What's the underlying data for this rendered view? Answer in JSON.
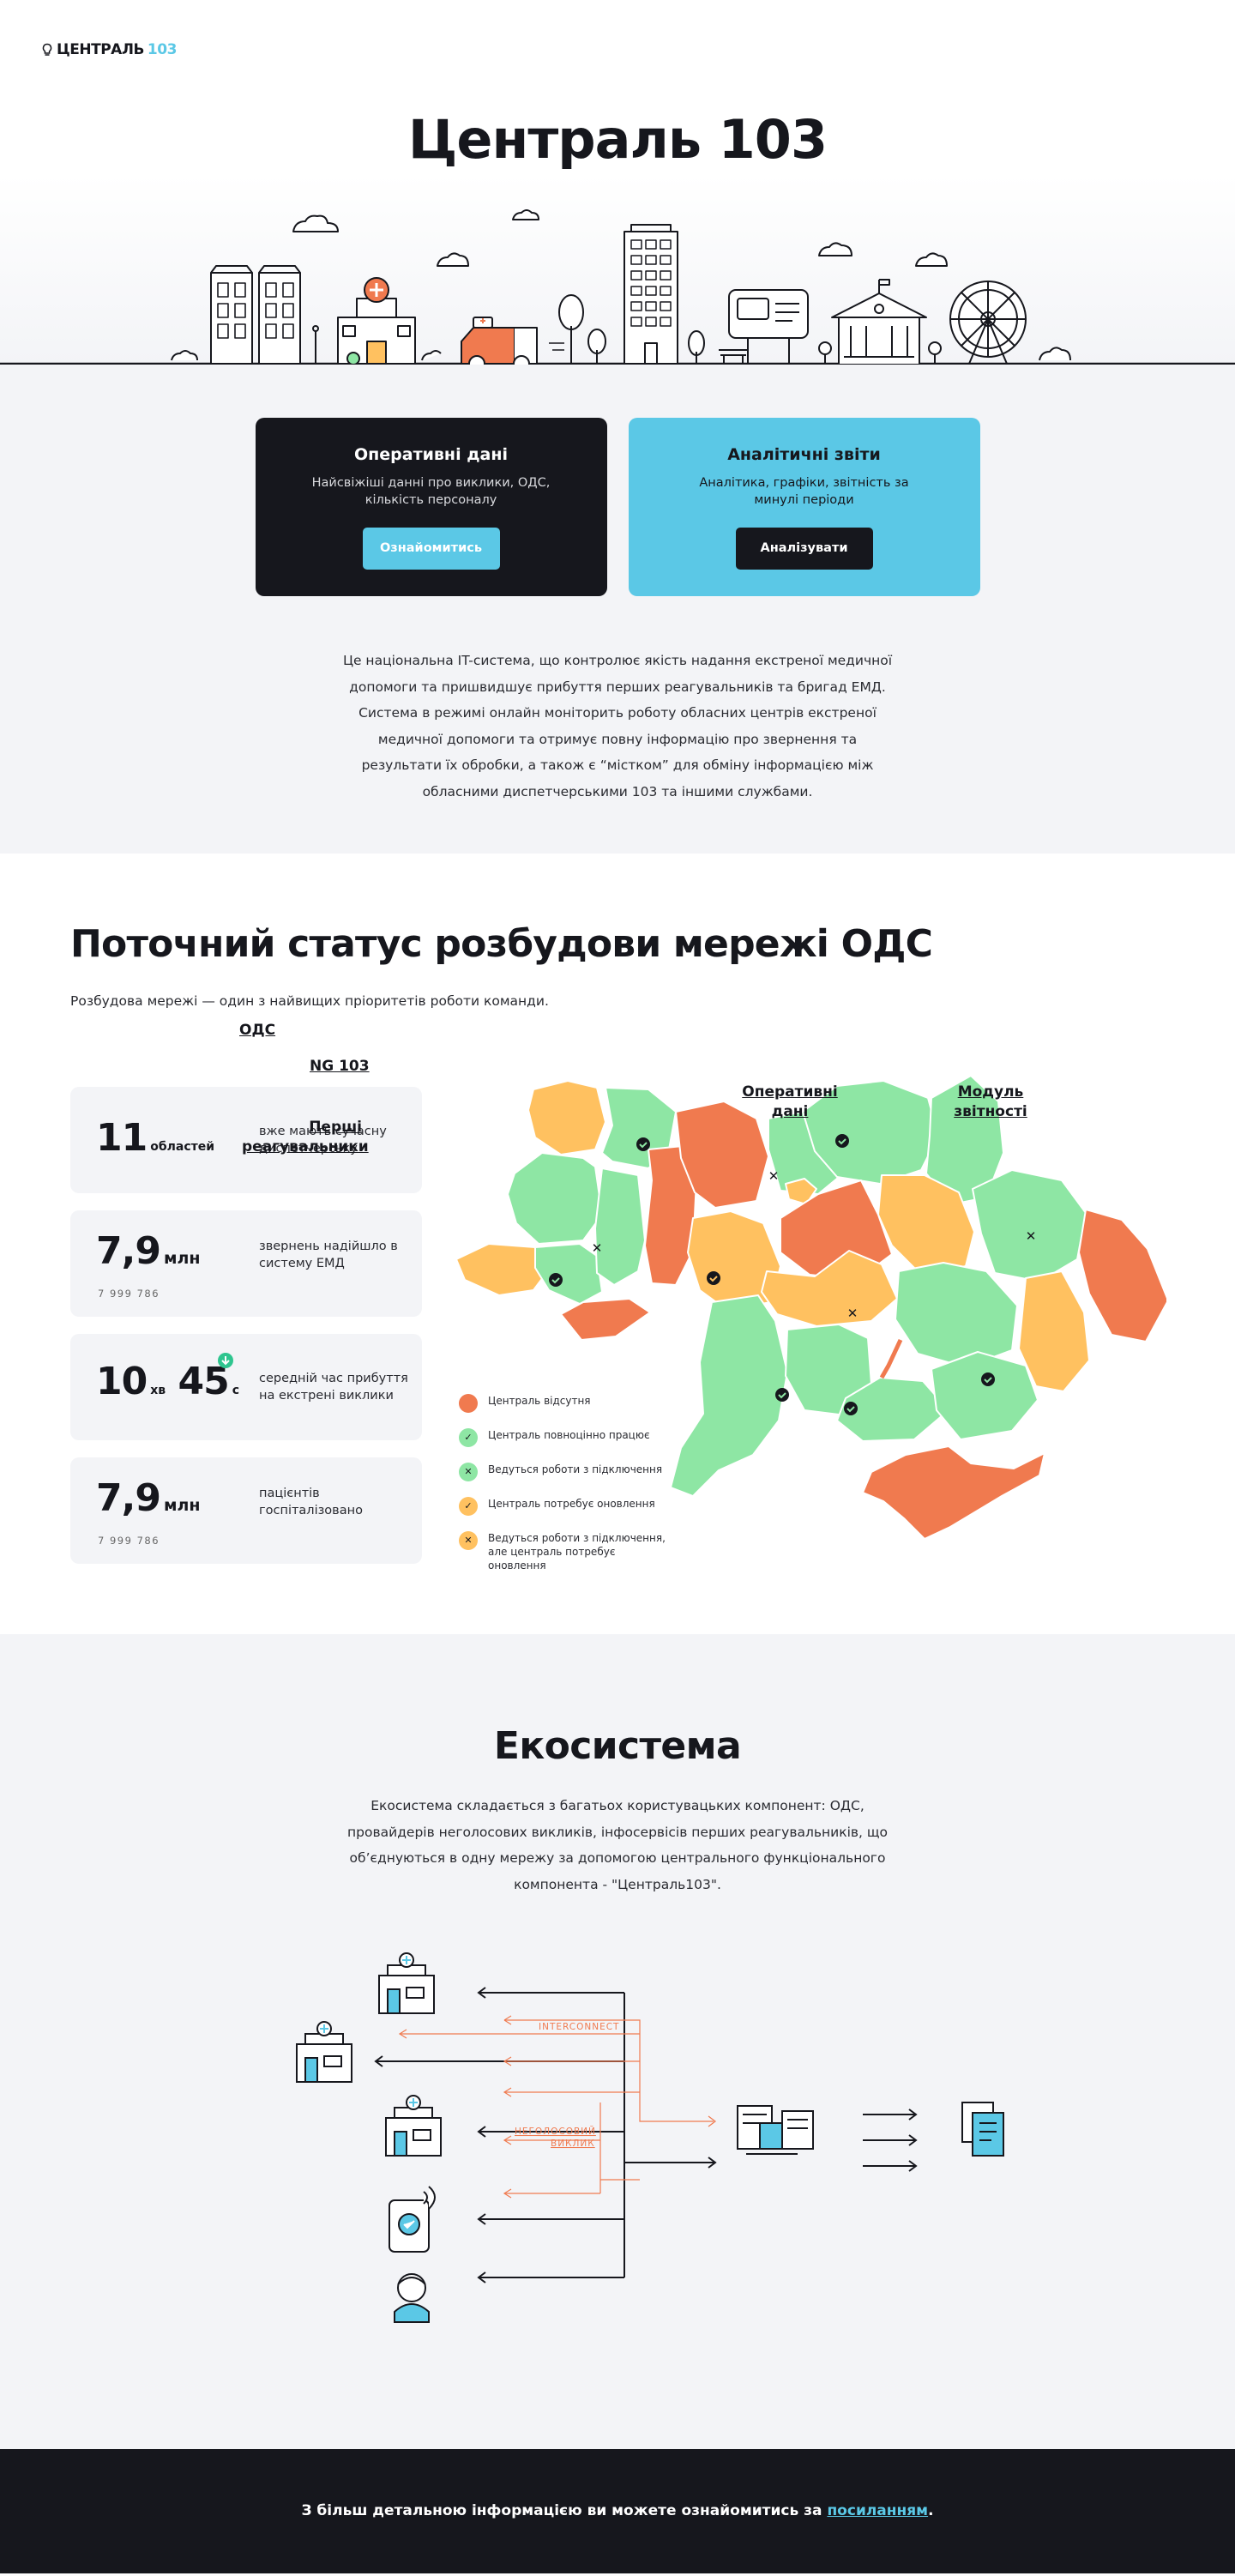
{
  "header": {
    "logo_text": "ЦЕНТРАЛЬ",
    "logo_number": "103",
    "title": "Централь 103"
  },
  "cards": [
    {
      "title": "Оперативні дані",
      "text": "Найсвіжіші данні про виклики, ОДС, кількість персоналу",
      "button": "Ознайомитись"
    },
    {
      "title": "Аналітичні звіти",
      "text": "Аналітика, графіки, звітність за минулі періоди",
      "button": "Аналізувати"
    }
  ],
  "intro": "Це національна IT-система, що контролює якість надання екстреної медичної допомоги та пришвидшує прибуття перших реагувальників та бригад ЕМД. Система в режимі онлайн моніторить роботу обласних центрів екстреної медичної допомоги та отримує повну інформацію про звернення та результати їх обробки, а також є “містком” для обміну інформацією між обласними диспетчерськими 103 та іншими службами.",
  "status": {
    "title": "Поточний статус розбудови мережі ОДС",
    "subtitle": "Розбудова мережі — один з найвищих пріоритетів роботи команди.",
    "stats": [
      {
        "value": "11",
        "unit": "областей",
        "desc": "вже мають сучасну диспетчерську",
        "digits": ""
      },
      {
        "value": "7,9",
        "unit": "млн",
        "desc": "звернень надійшло в систему ЕМД",
        "digits": "7  999  786"
      },
      {
        "value_min": "10",
        "unit_min": "хв",
        "value_sec": "45",
        "unit_sec": "с",
        "desc": "середній час прибуття на екстрені виклики"
      },
      {
        "value": "7,9",
        "unit": "млн",
        "desc": "пацієнтів госпіталізовано",
        "digits": "7  999  786"
      }
    ],
    "legend": [
      {
        "label": "Централь відсутня",
        "color": "#f07a4f",
        "icon": ""
      },
      {
        "label": "Централь повноцінно працює",
        "color": "#8ee6a4",
        "icon": "check-shield-icon"
      },
      {
        "label": "Ведуться роботи з підключення",
        "color": "#8ee6a4",
        "icon": "tools-icon"
      },
      {
        "label": "Централь потребує оновлення",
        "color": "#ffc160",
        "icon": "check-shield-icon"
      },
      {
        "label": "Ведуться роботи з підключення, але централь потребує оновлення",
        "color": "#ffc160",
        "icon": "tools-icon"
      }
    ],
    "colors": {
      "absent": "#f07a4f",
      "working": "#8ee6a4",
      "update": "#ffc160"
    }
  },
  "ecosystem": {
    "title": "Екосистема",
    "text": "Екосистема складається з багатьох користувацьких компонент: ОДС, провайдерів неголосових викликів, інфосервісів перших реагувальників, що об’єднуються в одну мережу за допомогою центрального функціонального компонента - \"Централь103\".",
    "labels": {
      "ods": "ОДС",
      "ng103": "NG 103",
      "responders": "Перші реагувальники",
      "operative": "Оперативні дані",
      "reports": "Модуль звітності",
      "interconnect": "INTERCONNECT",
      "nonvoice": "НЕГОЛОСОВИЙ ВИКЛИК"
    }
  },
  "footer": {
    "text": "З більш детальною інформацією ви можете ознайомитись за",
    "link": "посиланням",
    "end": "."
  }
}
